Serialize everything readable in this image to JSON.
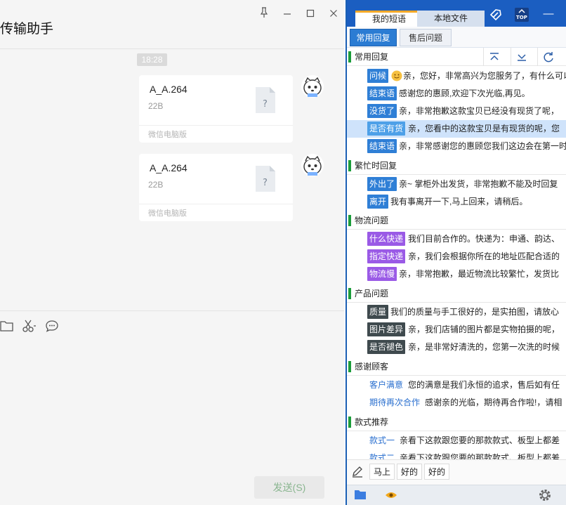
{
  "chat": {
    "title": "传输助手",
    "window_controls": {
      "pin": "⚲",
      "minimize": "—",
      "maximize": "☐",
      "close": "✕"
    },
    "timestamp": "18:28",
    "messages": [
      {
        "file_name": "A_A.264",
        "file_size": "22B",
        "source": "微信电脑版"
      },
      {
        "file_name": "A_A.264",
        "file_size": "22B",
        "source": "微信电脑版"
      }
    ],
    "send_label": "发送(S)"
  },
  "panel": {
    "tabs": [
      "我的短语",
      "本地文件"
    ],
    "top_icons": {
      "top_label": "TOP",
      "minimize": "—"
    },
    "sub_tabs": [
      "常用回复",
      "售后问题"
    ],
    "groups": [
      {
        "name": "常用回复",
        "items": [
          {
            "tag": "问候",
            "text": "亲，您好，非常高兴为您服务了，有什么可以帮您"
          },
          {
            "tag": "结束语",
            "text": "感谢您的惠顾,欢迎下次光临,再见。"
          },
          {
            "tag": "没货了",
            "text": "亲，非常抱歉这款宝贝已经没有现货了呢，"
          },
          {
            "tag": "是否有货",
            "text": "亲，您看中的这款宝贝是有现货的呢，您"
          },
          {
            "tag": "结束语",
            "text": "亲，非常感谢您的惠顾您我们这边会在第一时"
          }
        ]
      },
      {
        "name": "繁忙时回复",
        "items": [
          {
            "tag": "外出了",
            "text": "亲~ 掌柜外出发货，非常抱歉不能及时回复"
          },
          {
            "tag": "离开",
            "text": "我有事离开一下,马上回来，请稍后。"
          }
        ]
      },
      {
        "name": "物流问题",
        "items": [
          {
            "tag": "什么快递",
            "text": "我们目前合作的。快递为：申通、韵达、"
          },
          {
            "tag": "指定快递",
            "text": "亲，我们会根据你所在的地址匹配合适的"
          },
          {
            "tag": "物流慢",
            "text": "亲，非常抱歉，最近物流比较繁忙，发货比"
          }
        ]
      },
      {
        "name": "产品问题",
        "items": [
          {
            "tag": "质量",
            "text": "我们的质量与手工很好的，是实拍图，请放心"
          },
          {
            "tag": "图片差异",
            "text": "亲，我们店铺的图片都是实物拍摄的呢，"
          },
          {
            "tag": "是否褪色",
            "text": "亲，是非常好清洗的，您第一次洗的时候"
          }
        ]
      },
      {
        "name": "感谢顾客",
        "items": [
          {
            "tag": "客户满意",
            "text": "您的满意是我们永恒的追求，售后如有任"
          },
          {
            "tag": "期待再次合作",
            "text": "感谢亲的光临，期待再合作啦!，请相"
          }
        ]
      },
      {
        "name": "款式推荐",
        "items": [
          {
            "tag": "款式一",
            "text": "亲看下这款跟您要的那款款式、板型上都差"
          },
          {
            "tag": "款式二",
            "text": "亲看下这款跟您要的那款款式、板型上都差"
          }
        ]
      }
    ],
    "quick_buttons": [
      "马上",
      "好的",
      "好的"
    ]
  },
  "colors": {
    "panel_blue": "#1b5ec1",
    "tag_blue": "#2f7fd6",
    "tag_purple": "#9a5ae6",
    "tag_dark": "#3f4a4e",
    "group_bar": "#1c9c3b",
    "send_text": "#89b58f"
  },
  "icons": {
    "left_tools": [
      "folder-icon",
      "scissors-icon",
      "chat-bubble-icon"
    ],
    "panel_top": [
      "tag-icon",
      "top-icon",
      "minimize-icon"
    ],
    "group_tools": [
      "collapse-all-icon",
      "expand-all-icon",
      "refresh-icon"
    ],
    "bottom": [
      "folder-icon",
      "eye-icon",
      "gear-icon"
    ],
    "quick": [
      "edit-icon"
    ]
  }
}
